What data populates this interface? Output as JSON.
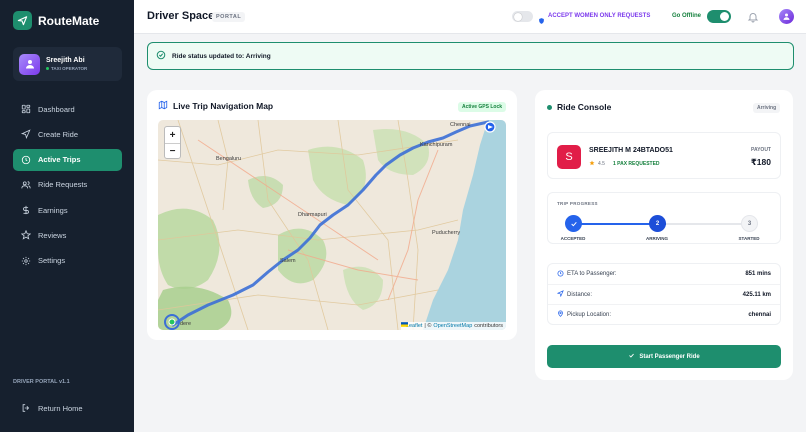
{
  "brand": {
    "name": "RouteMate"
  },
  "user": {
    "name": "Sreejith Abi",
    "role": "TAXI OPERATOR"
  },
  "nav": {
    "items": [
      {
        "label": "Dashboard",
        "icon": "grid-icon"
      },
      {
        "label": "Create Ride",
        "icon": "send-icon"
      },
      {
        "label": "Active Trips",
        "icon": "clock-icon",
        "active": true
      },
      {
        "label": "Ride Requests",
        "icon": "users-icon"
      },
      {
        "label": "Earnings",
        "icon": "dollar-icon"
      },
      {
        "label": "Reviews",
        "icon": "star-icon"
      },
      {
        "label": "Settings",
        "icon": "gear-icon"
      }
    ]
  },
  "footer": {
    "version": "DRIVER PORTAL v1.1",
    "return_home": "Return Home"
  },
  "header": {
    "title": "Driver Space",
    "badge": "PORTAL",
    "women_only_label": "ACCEPT WOMEN ONLY REQUESTS",
    "women_only_on": false,
    "go_offline_label": "Go Offline",
    "online_on": true
  },
  "status_banner": {
    "text": "Ride status updated to: Arriving"
  },
  "map": {
    "title": "Live Trip Navigation Map",
    "gps_badge": "Active GPS Lock",
    "zoom_in": "+",
    "zoom_out": "−",
    "attribution_leaflet": "Leaflet",
    "attribution_sep": "| ©",
    "attribution_osm": "OpenStreetMap",
    "attribution_contrib": "contributors",
    "labels": {
      "bengaluru": "Bengaluru",
      "salem": "Salem",
      "chennai": "Chennai",
      "kanchipuram": "Kanchipuram",
      "dharmapuri": "Dharmapuri",
      "puducherry": "Puducherry",
      "dere": "dere"
    }
  },
  "console": {
    "title": "Ride Console",
    "status_badge": "Arriving",
    "passenger": {
      "initial": "S",
      "name": "SREEJITH M 24BTADO51",
      "rating": "4.5",
      "pax": "1 PAX REQUESTED",
      "payout_label": "PAYOUT",
      "payout_value": "₹180"
    },
    "progress": {
      "title": "TRIP PROGRESS",
      "fraction": 0.5,
      "steps": [
        {
          "num": "1",
          "label": "ACCEPTED",
          "state": "done"
        },
        {
          "num": "2",
          "label": "ARRIVING",
          "state": "current"
        },
        {
          "num": "3",
          "label": "STARTED",
          "state": "todo"
        }
      ]
    },
    "info": [
      {
        "key": "ETA to Passenger:",
        "value": "851 mins",
        "icon": "clock-icon"
      },
      {
        "key": "Distance:",
        "value": "425.11 km",
        "icon": "send-icon"
      },
      {
        "key": "Pickup Location:",
        "value": "chennai",
        "icon": "pin-icon"
      }
    ],
    "start_button": "Start Passenger Ride"
  },
  "colors": {
    "accent": "#1e8e6e",
    "sidebar": "#16202e",
    "women_purple": "#7c3aed",
    "route_blue": "#3b6fd6"
  }
}
